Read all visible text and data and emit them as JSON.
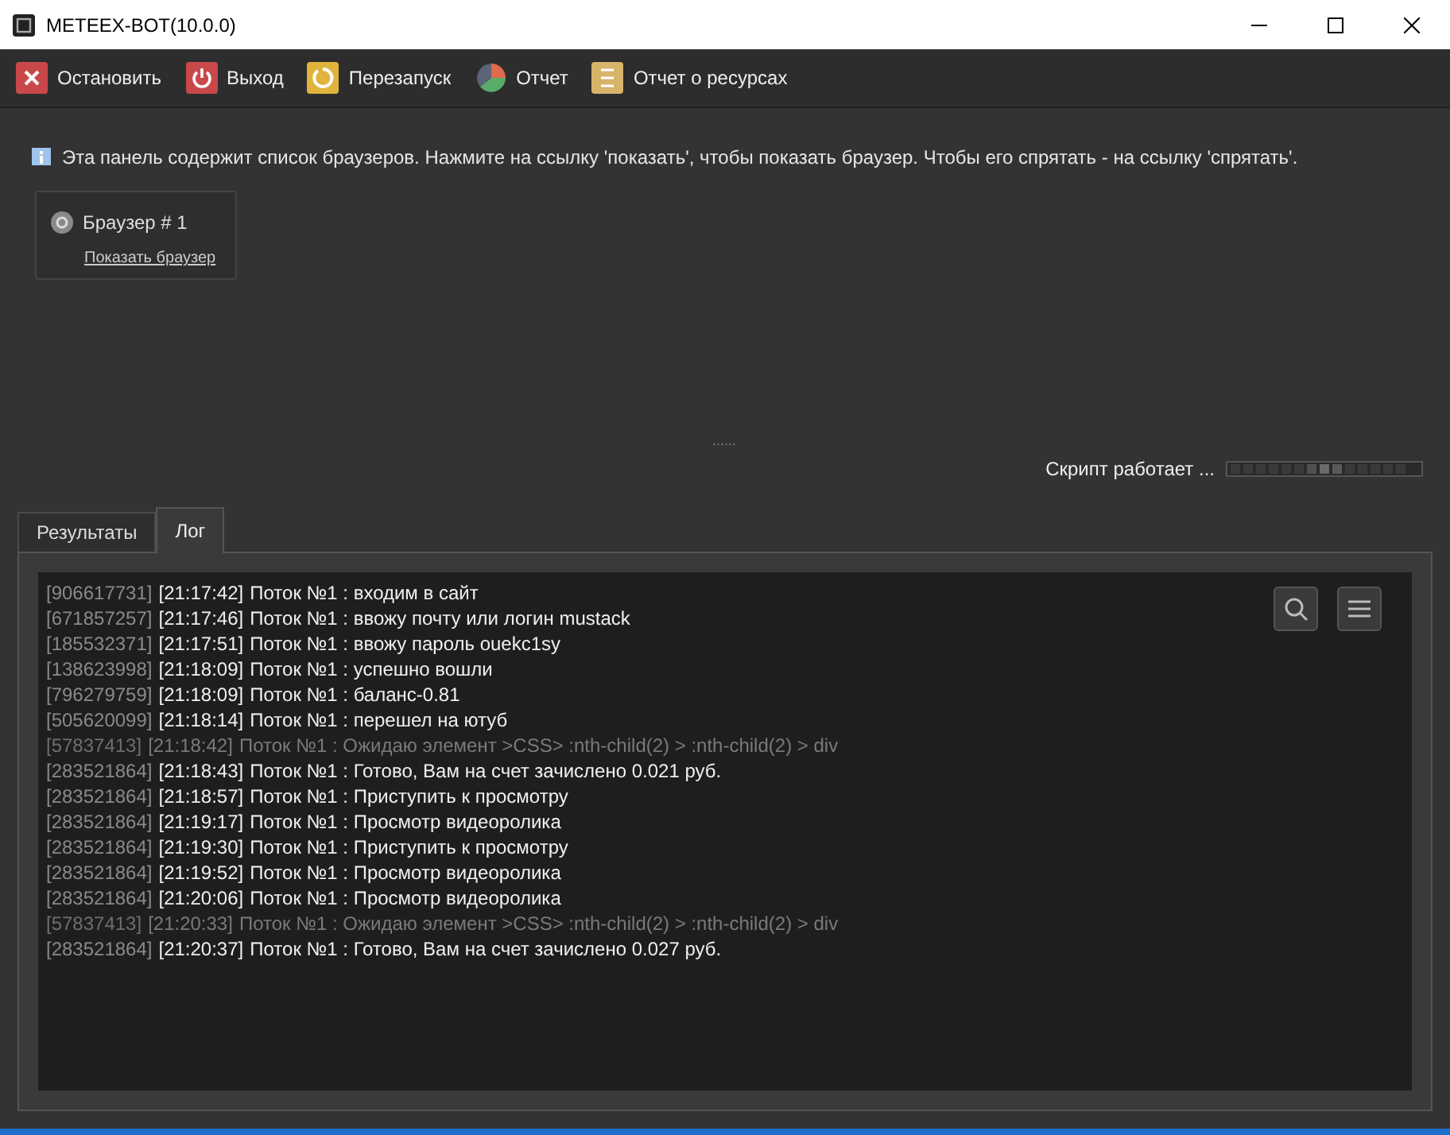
{
  "window": {
    "title": "METEEX-BOT(10.0.0)"
  },
  "toolbar": [
    {
      "label": "Остановить",
      "kind": "stop"
    },
    {
      "label": "Выход",
      "kind": "exit"
    },
    {
      "label": "Перезапуск",
      "kind": "restart"
    },
    {
      "label": "Отчет",
      "kind": "report"
    },
    {
      "label": "Отчет о ресурсах",
      "kind": "resources"
    }
  ],
  "info": "Эта панель содержит список браузеров. Нажмите на ссылку 'показать', чтобы показать браузер. Чтобы его спрятать - на ссылку 'спрятать'.",
  "browsers": [
    {
      "name": "Браузер # 1",
      "link": "Показать браузер"
    }
  ],
  "splitter": "......",
  "status": "Скрипт работает ...",
  "tabs": [
    {
      "label": "Результаты",
      "selected": false
    },
    {
      "label": "Лог",
      "selected": true
    }
  ],
  "log": [
    {
      "id": "[906617731]",
      "time": "[21:17:42]",
      "message": "Поток №1 : входим в сайт",
      "kind": "normal"
    },
    {
      "id": "[671857257]",
      "time": "[21:17:46]",
      "message": "Поток №1 : ввожу почту или логин mustack",
      "kind": "normal"
    },
    {
      "id": "[185532371]",
      "time": "[21:17:51]",
      "message": "Поток №1 : ввожу пароль ouekc1sy",
      "kind": "normal"
    },
    {
      "id": "[138623998]",
      "time": "[21:18:09]",
      "message": "Поток №1 : успешно вошли",
      "kind": "normal"
    },
    {
      "id": "[796279759]",
      "time": "[21:18:09]",
      "message": "Поток №1 : баланс-0.81",
      "kind": "normal"
    },
    {
      "id": "[505620099]",
      "time": "[21:18:14]",
      "message": "Поток №1 : перешел на ютуб",
      "kind": "normal"
    },
    {
      "id": "[57837413]",
      "time": "[21:18:42]",
      "message": "Поток №1 : Ожидаю элемент >CSS> :nth-child(2) > :nth-child(2) > div",
      "kind": "waiting"
    },
    {
      "id": "[283521864]",
      "time": "[21:18:43]",
      "message": "Поток №1 : Готово, Вам на счет зачислено 0.021 руб.",
      "kind": "normal"
    },
    {
      "id": "[283521864]",
      "time": "[21:18:57]",
      "message": "Поток №1 : Приступить к просмотру",
      "kind": "normal"
    },
    {
      "id": "[283521864]",
      "time": "[21:19:17]",
      "message": "Поток №1 : Просмотр видеоролика",
      "kind": "normal"
    },
    {
      "id": "[283521864]",
      "time": "[21:19:30]",
      "message": "Поток №1 : Приступить к просмотру",
      "kind": "normal"
    },
    {
      "id": "[283521864]",
      "time": "[21:19:52]",
      "message": "Поток №1 : Просмотр видеоролика",
      "kind": "normal"
    },
    {
      "id": "[283521864]",
      "time": "[21:20:06]",
      "message": "Поток №1 : Просмотр видеоролика",
      "kind": "normal"
    },
    {
      "id": "[57837413]",
      "time": "[21:20:33]",
      "message": "Поток №1 : Ожидаю элемент >CSS> :nth-child(2) > :nth-child(2) > div",
      "kind": "waiting"
    },
    {
      "id": "[283521864]",
      "time": "[21:20:37]",
      "message": "Поток №1 : Готово, Вам на счет зачислено 0.027 руб.",
      "kind": "normal"
    }
  ]
}
